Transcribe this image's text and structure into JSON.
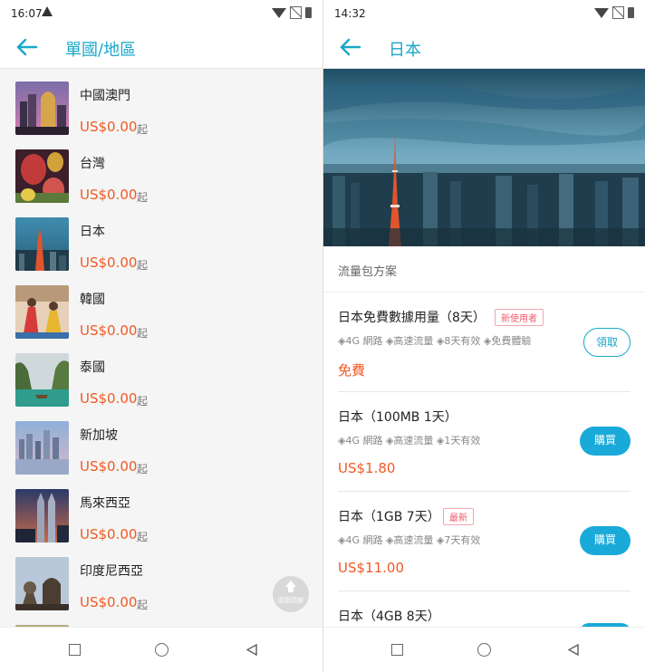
{
  "left": {
    "status": {
      "time": "16:07"
    },
    "title": "單國/地區",
    "countries": [
      {
        "name": "中國澳門",
        "price": "US$0.00",
        "suffix": "起"
      },
      {
        "name": "台灣",
        "price": "US$0.00",
        "suffix": "起"
      },
      {
        "name": "日本",
        "price": "US$0.00",
        "suffix": "起"
      },
      {
        "name": "韓國",
        "price": "US$0.00",
        "suffix": "起"
      },
      {
        "name": "泰國",
        "price": "US$0.00",
        "suffix": "起"
      },
      {
        "name": "新加坡",
        "price": "US$0.00",
        "suffix": "起"
      },
      {
        "name": "馬來西亞",
        "price": "US$0.00",
        "suffix": "起"
      },
      {
        "name": "印度尼西亞",
        "price": "US$0.00",
        "suffix": "起"
      }
    ],
    "fab_label": "回到頂部"
  },
  "right": {
    "status": {
      "time": "14:32"
    },
    "title": "日本",
    "section_title": "流量包方案",
    "plans": [
      {
        "name": "日本免費數據用量（8天）",
        "tag": "新使用者",
        "features": "◈4G 網路 ◈高速流量 ◈8天有效 ◈免費體驗",
        "price": "免費",
        "button": "領取"
      },
      {
        "name": "日本（100MB 1天）",
        "tag": "",
        "features": "◈4G 網路 ◈高速流量 ◈1天有效",
        "price": "US$1.80",
        "button": "購買"
      },
      {
        "name": "日本（1GB 7天）",
        "tag": "最新",
        "features": "◈4G 網路 ◈高速流量 ◈7天有效",
        "price": "US$11.00",
        "button": "購買"
      },
      {
        "name": "日本（4GB 8天）",
        "tag": "",
        "features": "",
        "price": "",
        "button": ""
      }
    ]
  },
  "colors": {
    "accent": "#1ba7c9",
    "price": "#f05a24",
    "tag": "#ef5a6e",
    "buy": "#1aaad9"
  },
  "icons": [
    "back-arrow-icon",
    "wifi-icon",
    "no-sim-icon",
    "battery-icon",
    "warning-icon",
    "scroll-top-icon",
    "recents-icon",
    "home-icon",
    "back-nav-icon"
  ]
}
